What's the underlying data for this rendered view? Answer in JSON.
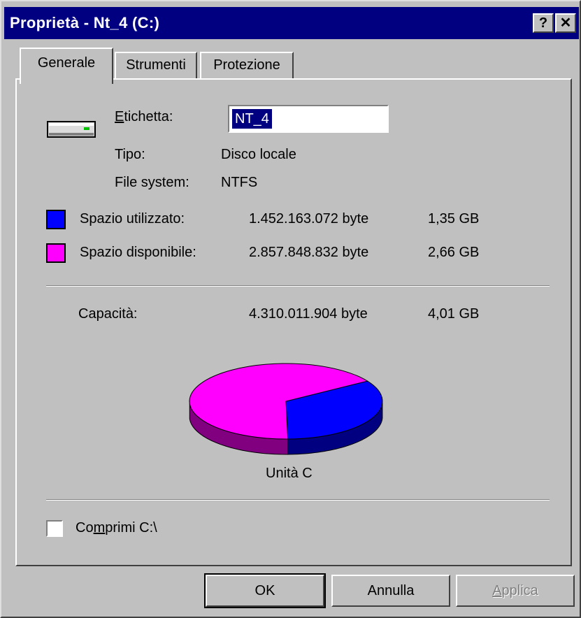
{
  "window": {
    "title": "Proprietà - Nt_4 (C:)",
    "help_button": "?",
    "close_button": "✕"
  },
  "tabs": [
    {
      "label": "Generale",
      "active": true
    },
    {
      "label": "Strumenti",
      "active": false
    },
    {
      "label": "Protezione",
      "active": false
    }
  ],
  "drive": {
    "icon": "hard-drive-icon",
    "label_caption_access_key": "E",
    "label_caption_rest": "tichetta:",
    "label_value": "NT_4",
    "type_caption": "Tipo:",
    "type_value": "Disco locale",
    "fs_caption": "File system:",
    "fs_value": "NTFS"
  },
  "space": {
    "used": {
      "label": "Spazio utilizzato:",
      "bytes": "1.452.163.072 byte",
      "size": "1,35 GB",
      "color": "#0000ff"
    },
    "free": {
      "label": "Spazio disponibile:",
      "bytes": "2.857.848.832 byte",
      "size": "2,66 GB",
      "color": "#ff00ff"
    },
    "capacity": {
      "label": "Capacità:",
      "bytes": "4.310.011.904 byte",
      "size": "4,01 GB"
    }
  },
  "chart_data": {
    "type": "pie",
    "title": "Unità C",
    "categories": [
      "Spazio utilizzato",
      "Spazio disponibile"
    ],
    "values": [
      1452163072,
      2857848832
    ],
    "colors": [
      "#0000ff",
      "#ff00ff"
    ]
  },
  "compress": {
    "checked": false,
    "label_pre": "Co",
    "label_access_key": "m",
    "label_post": "primi C:\\"
  },
  "buttons": {
    "ok": "OK",
    "cancel": "Annulla",
    "apply_access_key": "A",
    "apply_rest": "pplica"
  }
}
